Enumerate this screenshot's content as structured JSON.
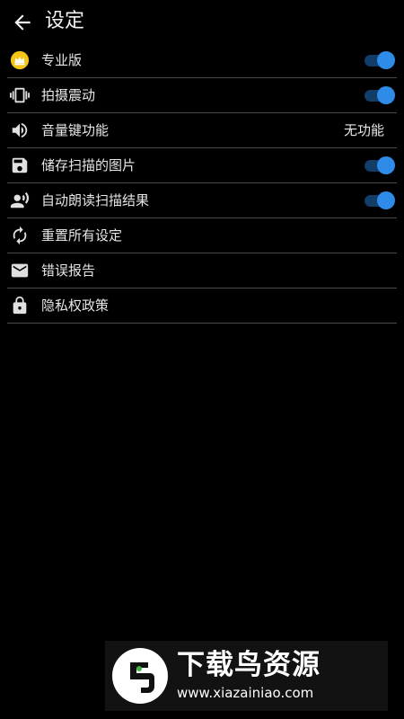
{
  "header": {
    "title": "设定",
    "back_icon": "arrow-back-icon"
  },
  "settings": [
    {
      "label": "专业版",
      "icon": "crown-icon",
      "toggle": true
    },
    {
      "label": "拍摄震动",
      "icon": "vibration-icon",
      "toggle": true
    },
    {
      "label": "音量键功能",
      "icon": "volume-icon",
      "value": "无功能"
    },
    {
      "label": "储存扫描的图片",
      "icon": "save-icon",
      "toggle": true
    },
    {
      "label": "自动朗读扫描结果",
      "icon": "speaker-person-icon",
      "toggle": true
    },
    {
      "label": "重置所有设定",
      "icon": "refresh-icon"
    },
    {
      "label": "错误报告",
      "icon": "mail-icon"
    },
    {
      "label": "隐私权政策",
      "icon": "lock-icon"
    }
  ],
  "colors": {
    "background": "#000000",
    "toggle_accent": "#2e8ce8",
    "crown_badge": "#f5c518",
    "divider": "#4a4a4a"
  },
  "watermark": {
    "title": "下载鸟资源",
    "url": "www.xiazainiao.com"
  }
}
